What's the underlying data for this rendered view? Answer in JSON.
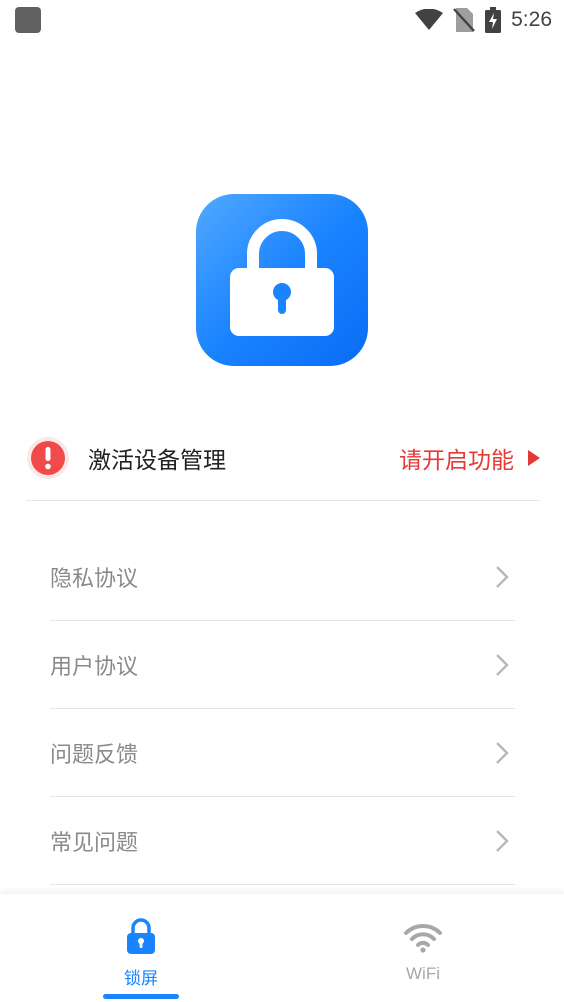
{
  "status_bar": {
    "time": "5:26",
    "icons": [
      "app-notification-icon",
      "wifi-icon",
      "no-sim-icon",
      "battery-charging-icon"
    ]
  },
  "app": {
    "logo_icon": "padlock-icon",
    "accent_color": "#1a84ff"
  },
  "activation": {
    "icon": "alert-icon",
    "label": "激活设备管理",
    "action_text": "请开启功能",
    "action_icon": "play-arrow-icon",
    "status_color": "#e53935"
  },
  "menu": {
    "items": [
      {
        "label": "隐私协议",
        "icon": "chevron-right-icon"
      },
      {
        "label": "用户协议",
        "icon": "chevron-right-icon"
      },
      {
        "label": "问题反馈",
        "icon": "chevron-right-icon"
      },
      {
        "label": "常见问题",
        "icon": "chevron-right-icon"
      }
    ]
  },
  "bottom_nav": {
    "tabs": [
      {
        "label": "锁屏",
        "icon": "lock-icon",
        "active": true
      },
      {
        "label": "WiFi",
        "icon": "wifi-icon",
        "active": false
      }
    ]
  }
}
